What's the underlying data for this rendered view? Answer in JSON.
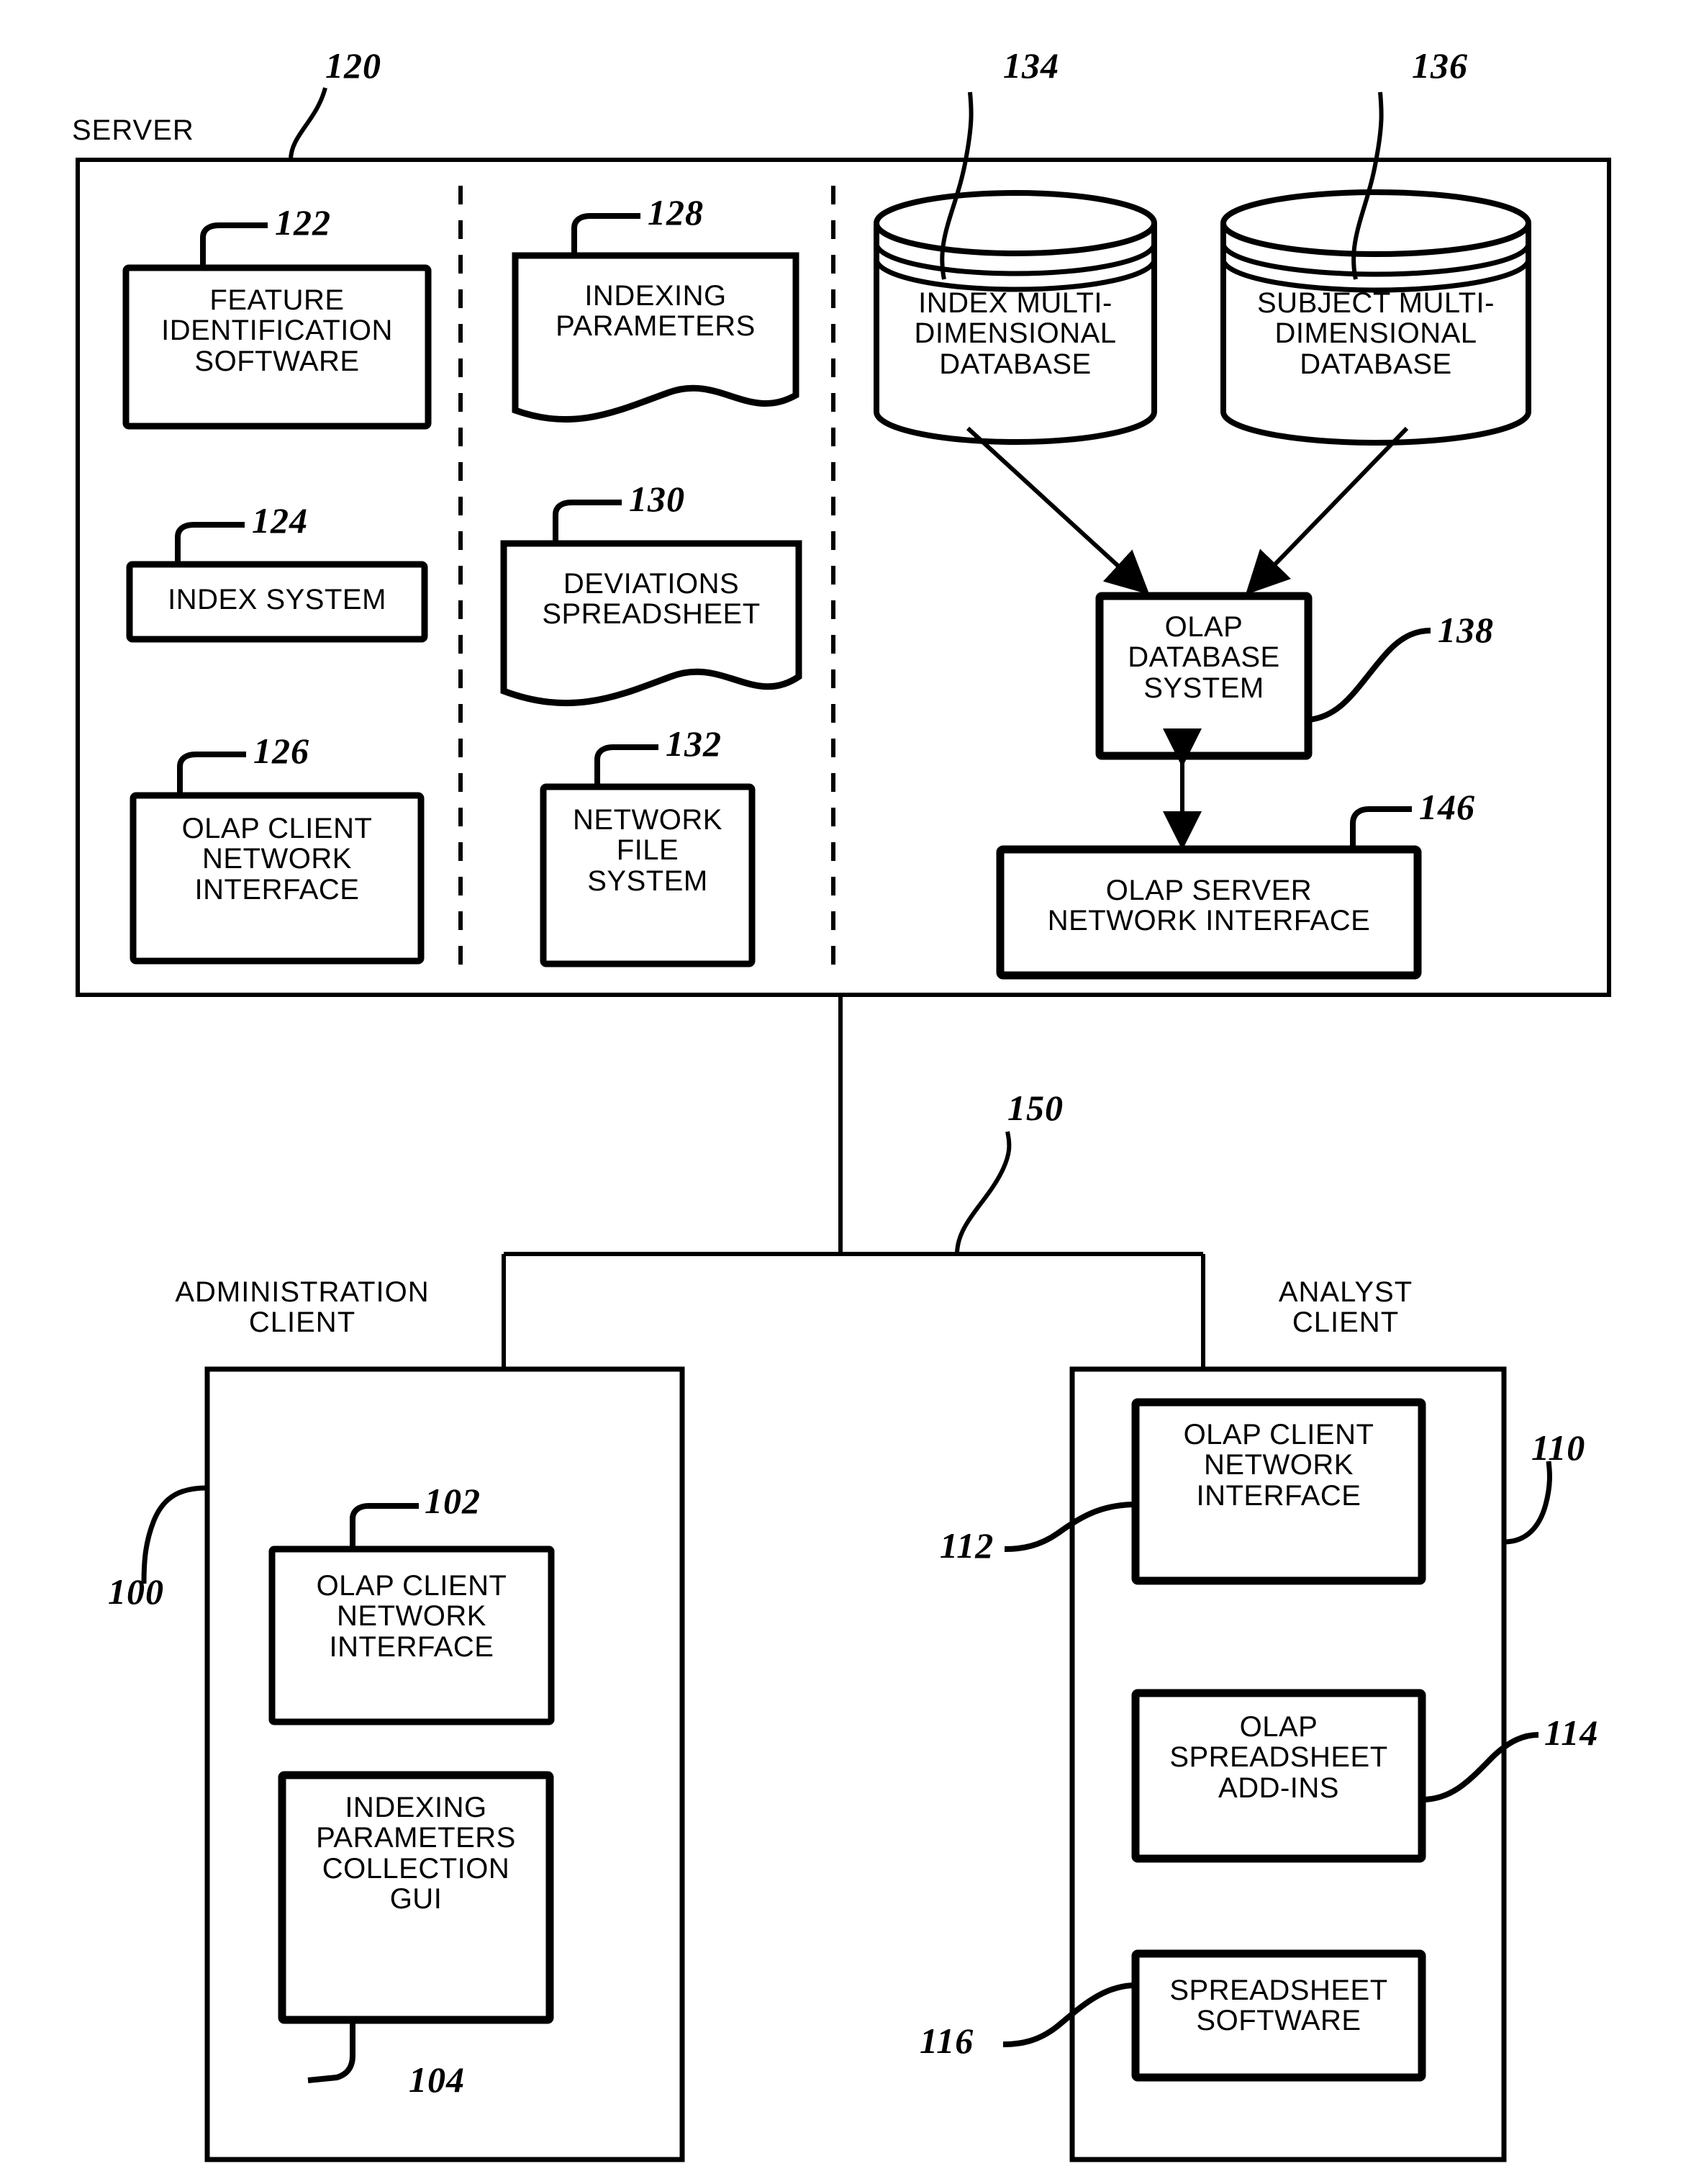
{
  "figure": {
    "type": "patent-block-diagram",
    "server": {
      "caption": "SERVER",
      "ref": "120",
      "columns": [
        {
          "name": "software-column",
          "items": [
            {
              "ref": "122",
              "label": "FEATURE\nIDENTIFICATION\nSOFTWARE",
              "shape": "rect"
            },
            {
              "ref": "124",
              "label": "INDEX SYSTEM",
              "shape": "rect"
            },
            {
              "ref": "126",
              "label": "OLAP CLIENT\nNETWORK\nINTERFACE",
              "shape": "rect"
            }
          ]
        },
        {
          "name": "data-column",
          "items": [
            {
              "ref": "128",
              "label": "INDEXING\nPARAMETERS",
              "shape": "document"
            },
            {
              "ref": "130",
              "label": "DEVIATIONS\nSPREADSHEET",
              "shape": "document"
            },
            {
              "ref": "132",
              "label": "NETWORK\nFILE\nSYSTEM",
              "shape": "rect"
            }
          ]
        },
        {
          "name": "olap-column",
          "items": [
            {
              "ref": "134",
              "label": "INDEX MULTI-\nDIMENSIONAL\nDATABASE",
              "shape": "cylinder"
            },
            {
              "ref": "136",
              "label": "SUBJECT MULTI-\nDIMENSIONAL\nDATABASE",
              "shape": "cylinder"
            },
            {
              "ref": "138",
              "label": "OLAP\nDATABASE\nSYSTEM",
              "shape": "rect"
            },
            {
              "ref": "146",
              "label": "OLAP SERVER\nNETWORK INTERFACE",
              "shape": "rect"
            }
          ]
        }
      ]
    },
    "network": {
      "ref": "150",
      "label": ""
    },
    "administration_client": {
      "caption": "ADMINISTRATION\nCLIENT",
      "ref": "100",
      "items": [
        {
          "ref": "102",
          "label": "OLAP CLIENT\nNETWORK\nINTERFACE",
          "shape": "rect"
        },
        {
          "ref": "104",
          "label": "INDEXING\nPARAMETERS\nCOLLECTION\nGUI",
          "shape": "rect"
        }
      ]
    },
    "analyst_client": {
      "caption": "ANALYST\nCLIENT",
      "ref": "110",
      "items": [
        {
          "ref": "112",
          "label": "OLAP CLIENT\nNETWORK\nINTERFACE",
          "shape": "rect"
        },
        {
          "ref": "114",
          "label": "OLAP\nSPREADSHEET\nADD-INS",
          "shape": "rect"
        },
        {
          "ref": "116",
          "label": "SPREADSHEET\nSOFTWARE",
          "shape": "rect"
        }
      ]
    },
    "connections": [
      {
        "from": "134",
        "to": "138",
        "arrow": "single"
      },
      {
        "from": "136",
        "to": "138",
        "arrow": "single"
      },
      {
        "from": "138",
        "to": "146",
        "arrow": "double"
      },
      {
        "from": "120",
        "to": "150",
        "arrow": "none"
      },
      {
        "from": "150",
        "to": "100",
        "arrow": "none"
      },
      {
        "from": "150",
        "to": "110",
        "arrow": "none"
      }
    ],
    "colors": {
      "ink": "#000000",
      "paper": "#ffffff"
    }
  }
}
